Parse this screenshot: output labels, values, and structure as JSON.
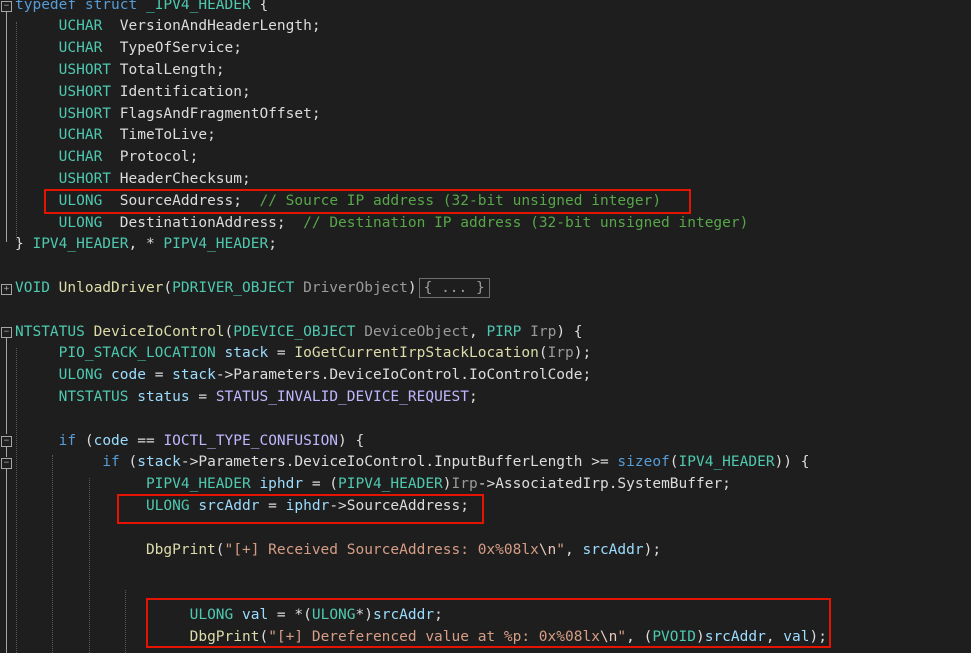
{
  "colors": {
    "background": "#1e1e1e",
    "keyword": "#569cd6",
    "type": "#4ec9b0",
    "function": "#dcdcaa",
    "param": "#9a9a9a",
    "variable": "#9cdcfe",
    "macro": "#beb7ff",
    "string": "#d69d85",
    "escape": "#e8c9bb",
    "comment": "#57a64a",
    "plain": "#dcdcdc",
    "highlight_box": "#e51400"
  },
  "icons": [
    "fold-collapse-icon",
    "fold-expand-icon"
  ],
  "collapsed_placeholder": "{ ... }",
  "lines": [
    [
      [
        "kw",
        "typedef"
      ],
      [
        "pl",
        " "
      ],
      [
        "kw",
        "struct"
      ],
      [
        "pl",
        " "
      ],
      [
        "ty",
        "_IPV4_HEADER"
      ],
      [
        "pl",
        " {"
      ]
    ],
    [
      [
        "pl",
        "     "
      ],
      [
        "ty",
        "UCHAR"
      ],
      [
        "pl",
        "  "
      ],
      [
        "pl",
        "VersionAndHeaderLength"
      ],
      [
        "pl",
        ";"
      ]
    ],
    [
      [
        "pl",
        "     "
      ],
      [
        "ty",
        "UCHAR"
      ],
      [
        "pl",
        "  "
      ],
      [
        "pl",
        "TypeOfService"
      ],
      [
        "pl",
        ";"
      ]
    ],
    [
      [
        "pl",
        "     "
      ],
      [
        "ty",
        "USHORT"
      ],
      [
        "pl",
        " "
      ],
      [
        "pl",
        "TotalLength"
      ],
      [
        "pl",
        ";"
      ]
    ],
    [
      [
        "pl",
        "     "
      ],
      [
        "ty",
        "USHORT"
      ],
      [
        "pl",
        " "
      ],
      [
        "pl",
        "Identification"
      ],
      [
        "pl",
        ";"
      ]
    ],
    [
      [
        "pl",
        "     "
      ],
      [
        "ty",
        "USHORT"
      ],
      [
        "pl",
        " "
      ],
      [
        "pl",
        "FlagsAndFragmentOffset"
      ],
      [
        "pl",
        ";"
      ]
    ],
    [
      [
        "pl",
        "     "
      ],
      [
        "ty",
        "UCHAR"
      ],
      [
        "pl",
        "  "
      ],
      [
        "pl",
        "TimeToLive"
      ],
      [
        "pl",
        ";"
      ]
    ],
    [
      [
        "pl",
        "     "
      ],
      [
        "ty",
        "UCHAR"
      ],
      [
        "pl",
        "  "
      ],
      [
        "pl",
        "Protocol"
      ],
      [
        "pl",
        ";"
      ]
    ],
    [
      [
        "pl",
        "     "
      ],
      [
        "ty",
        "USHORT"
      ],
      [
        "pl",
        " "
      ],
      [
        "pl",
        "HeaderChecksum"
      ],
      [
        "pl",
        ";"
      ]
    ],
    [
      [
        "pl",
        "     "
      ],
      [
        "ty",
        "ULONG"
      ],
      [
        "pl",
        "  "
      ],
      [
        "pl",
        "SourceAddress"
      ],
      [
        "pl",
        ";  "
      ],
      [
        "cm",
        "// Source IP address (32-bit unsigned integer)"
      ]
    ],
    [
      [
        "pl",
        "     "
      ],
      [
        "ty",
        "ULONG"
      ],
      [
        "pl",
        "  "
      ],
      [
        "pl",
        "DestinationAddress"
      ],
      [
        "pl",
        ";  "
      ],
      [
        "cm",
        "// Destination IP address (32-bit unsigned integer)"
      ]
    ],
    [
      [
        "pl",
        "} "
      ],
      [
        "ty",
        "IPV4_HEADER"
      ],
      [
        "pl",
        ", * "
      ],
      [
        "ty",
        "PIPV4_HEADER"
      ],
      [
        "pl",
        ";"
      ]
    ],
    [],
    [
      [
        "ty",
        "VOID"
      ],
      [
        "pl",
        " "
      ],
      [
        "fn",
        "UnloadDriver"
      ],
      [
        "pl",
        "("
      ],
      [
        "ty",
        "PDRIVER_OBJECT"
      ],
      [
        "pl",
        " "
      ],
      [
        "pa",
        "DriverObject"
      ],
      [
        "pl",
        ")"
      ]
    ],
    [],
    [
      [
        "ty",
        "NTSTATUS"
      ],
      [
        "pl",
        " "
      ],
      [
        "fn",
        "DeviceIoControl"
      ],
      [
        "pl",
        "("
      ],
      [
        "ty",
        "PDEVICE_OBJECT"
      ],
      [
        "pl",
        " "
      ],
      [
        "pa",
        "DeviceObject"
      ],
      [
        "pl",
        ", "
      ],
      [
        "ty",
        "PIRP"
      ],
      [
        "pl",
        " "
      ],
      [
        "pa",
        "Irp"
      ],
      [
        "pl",
        ") {"
      ]
    ],
    [
      [
        "pl",
        "     "
      ],
      [
        "ty",
        "PIO_STACK_LOCATION"
      ],
      [
        "pl",
        " "
      ],
      [
        "va",
        "stack"
      ],
      [
        "pl",
        " = "
      ],
      [
        "fn",
        "IoGetCurrentIrpStackLocation"
      ],
      [
        "pl",
        "("
      ],
      [
        "pa",
        "Irp"
      ],
      [
        "pl",
        ");"
      ]
    ],
    [
      [
        "pl",
        "     "
      ],
      [
        "ty",
        "ULONG"
      ],
      [
        "pl",
        " "
      ],
      [
        "va",
        "code"
      ],
      [
        "pl",
        " = "
      ],
      [
        "va",
        "stack"
      ],
      [
        "pl",
        "->"
      ],
      [
        "pl",
        "Parameters.DeviceIoControl.IoControlCode"
      ],
      [
        "pl",
        ";"
      ]
    ],
    [
      [
        "pl",
        "     "
      ],
      [
        "ty",
        "NTSTATUS"
      ],
      [
        "pl",
        " "
      ],
      [
        "va",
        "status"
      ],
      [
        "pl",
        " = "
      ],
      [
        "ma",
        "STATUS_INVALID_DEVICE_REQUEST"
      ],
      [
        "pl",
        ";"
      ]
    ],
    [],
    [
      [
        "pl",
        "     "
      ],
      [
        "kw",
        "if"
      ],
      [
        "pl",
        " ("
      ],
      [
        "va",
        "code"
      ],
      [
        "pl",
        " == "
      ],
      [
        "ma",
        "IOCTL_TYPE_CONFUSION"
      ],
      [
        "pl",
        ") {"
      ]
    ],
    [
      [
        "pl",
        "          "
      ],
      [
        "kw",
        "if"
      ],
      [
        "pl",
        " ("
      ],
      [
        "va",
        "stack"
      ],
      [
        "pl",
        "->"
      ],
      [
        "pl",
        "Parameters.DeviceIoControl.InputBufferLength >= "
      ],
      [
        "kw",
        "sizeof"
      ],
      [
        "pl",
        "("
      ],
      [
        "ty",
        "IPV4_HEADER"
      ],
      [
        "pl",
        ")) {"
      ]
    ],
    [
      [
        "pl",
        "               "
      ],
      [
        "ty",
        "PIPV4_HEADER"
      ],
      [
        "pl",
        " "
      ],
      [
        "va",
        "iphdr"
      ],
      [
        "pl",
        " = ("
      ],
      [
        "ty",
        "PIPV4_HEADER"
      ],
      [
        "pl",
        ")"
      ],
      [
        "pa",
        "Irp"
      ],
      [
        "pl",
        "->"
      ],
      [
        "pl",
        "AssociatedIrp.SystemBuffer;"
      ]
    ],
    [
      [
        "pl",
        "               "
      ],
      [
        "ty",
        "ULONG"
      ],
      [
        "pl",
        " "
      ],
      [
        "va",
        "srcAddr"
      ],
      [
        "pl",
        " = "
      ],
      [
        "va",
        "iphdr"
      ],
      [
        "pl",
        "->"
      ],
      [
        "pl",
        "SourceAddress;"
      ]
    ],
    [],
    [
      [
        "pl",
        "               "
      ],
      [
        "fn",
        "DbgPrint"
      ],
      [
        "pl",
        "("
      ],
      [
        "st",
        "\"[+] Received SourceAddress: 0x%08lx"
      ],
      [
        "es",
        "\\n"
      ],
      [
        "st",
        "\""
      ],
      [
        "pl",
        ", "
      ],
      [
        "va",
        "srcAddr"
      ],
      [
        "pl",
        ");"
      ]
    ],
    [],
    [],
    [
      [
        "pl",
        "                    "
      ],
      [
        "ty",
        "ULONG"
      ],
      [
        "pl",
        " "
      ],
      [
        "va",
        "val"
      ],
      [
        "pl",
        " = *("
      ],
      [
        "ty",
        "ULONG"
      ],
      [
        "pl",
        "*)"
      ],
      [
        "va",
        "srcAddr"
      ],
      [
        "pl",
        ";"
      ]
    ],
    [
      [
        "pl",
        "                    "
      ],
      [
        "fn",
        "DbgPrint"
      ],
      [
        "pl",
        "("
      ],
      [
        "st",
        "\"[+] Dereferenced value at %p: 0x%08lx"
      ],
      [
        "es",
        "\\n"
      ],
      [
        "st",
        "\""
      ],
      [
        "pl",
        ", ("
      ],
      [
        "ty",
        "PVOID"
      ],
      [
        "pl",
        ")"
      ],
      [
        "va",
        "srcAddr"
      ],
      [
        "pl",
        ", "
      ],
      [
        "va",
        "val"
      ],
      [
        "pl",
        ");"
      ]
    ]
  ]
}
